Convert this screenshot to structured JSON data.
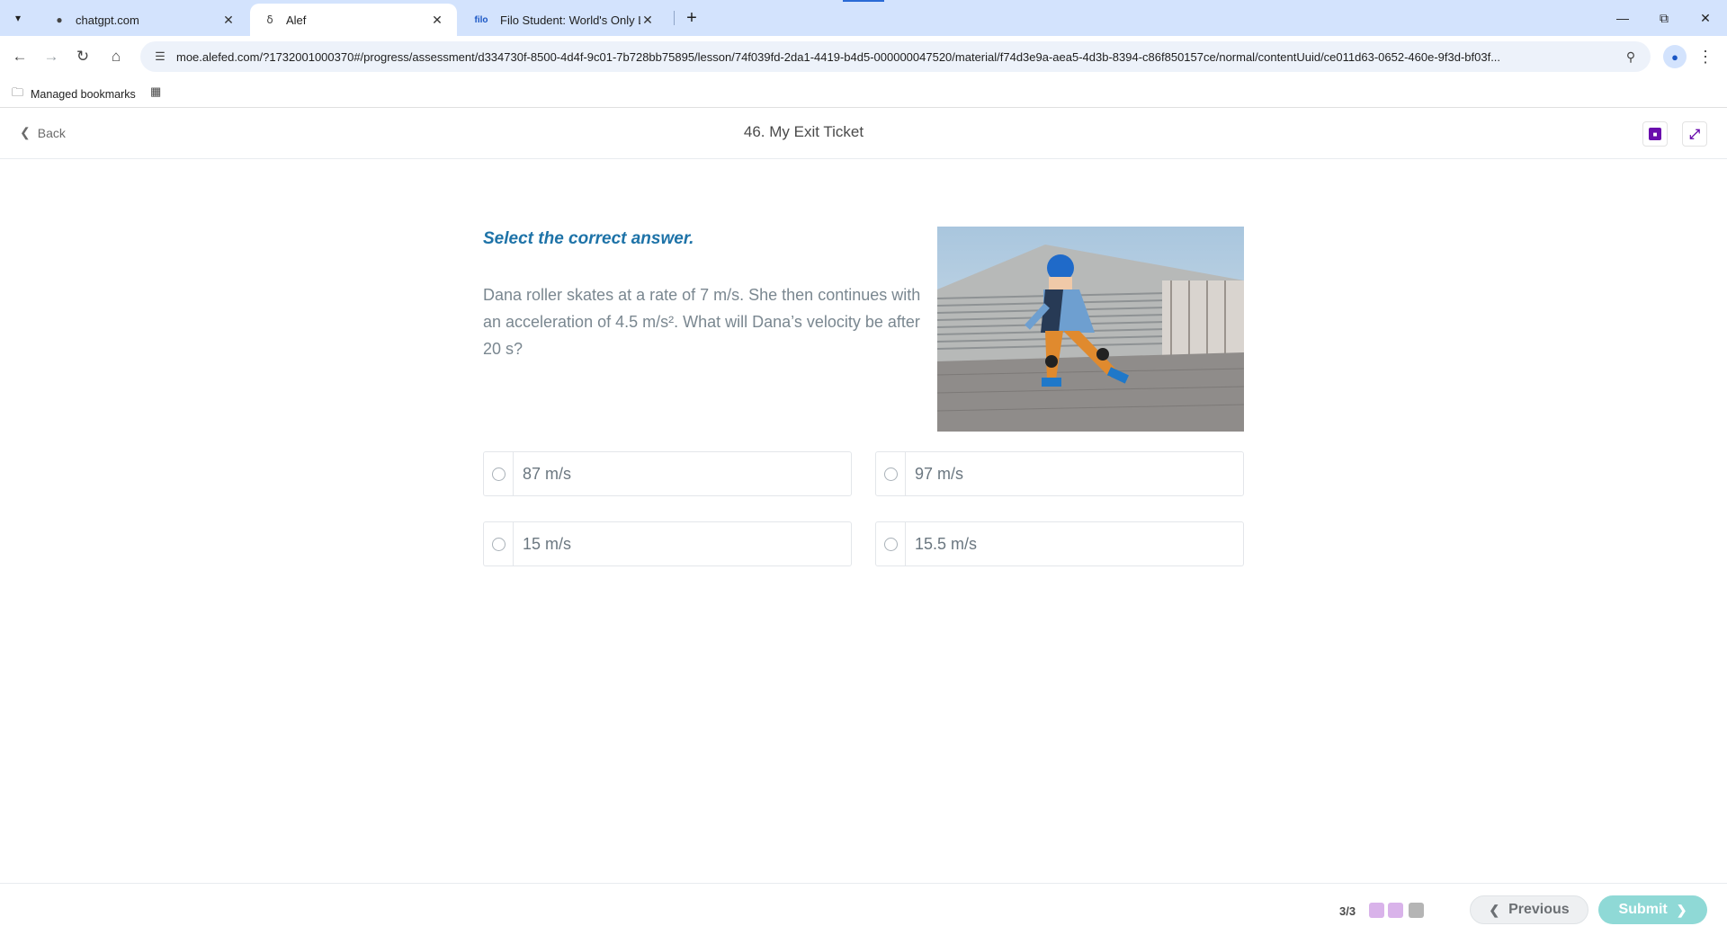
{
  "browser": {
    "tabs": [
      {
        "title": "chatgpt.com",
        "favicon": "globe-icon",
        "active": false
      },
      {
        "title": "Alef",
        "favicon": "alef-icon",
        "active": true
      },
      {
        "title": "Filo Student: World's Only Live",
        "favicon": "filo-icon",
        "favicon_text": "filo",
        "active": false
      }
    ],
    "url_host": "moe.alefed.com",
    "url_path": "/?1732001000370#/progress/assessment/d334730f-8500-4d4f-9c01-7b728bb75895/lesson/74f039fd-2da1-4419-b4d5-000000047520/material/f74d3e9a-aea5-4d3b-8394-c86f850157ce/normal/contentUuid/ce011d63-0652-460e-9f3d-bf03f...",
    "bookmarks": [
      {
        "label": "Managed bookmarks",
        "icon": "folder-icon"
      }
    ]
  },
  "header": {
    "back_label": "Back",
    "title": "46. My Exit Ticket"
  },
  "question": {
    "instruction": "Select the correct answer.",
    "text": "Dana roller skates at a rate of 7 m/s. She then continues with an acceleration of 4.5 m/s². What will Dana’s velocity be after 20 s?",
    "options": [
      "87 m/s",
      "97 m/s",
      "15 m/s",
      "15.5 m/s"
    ],
    "image_alt": "roller-skater-photo"
  },
  "footer": {
    "pager": "3/3",
    "previous_label": "Previous",
    "submit_label": "Submit"
  },
  "colors": {
    "accent_blue": "#1e73a8",
    "dot_done": "#d9b3ea",
    "dot_current": "#b5b5b5",
    "submit_teal": "#8fd9d6"
  }
}
